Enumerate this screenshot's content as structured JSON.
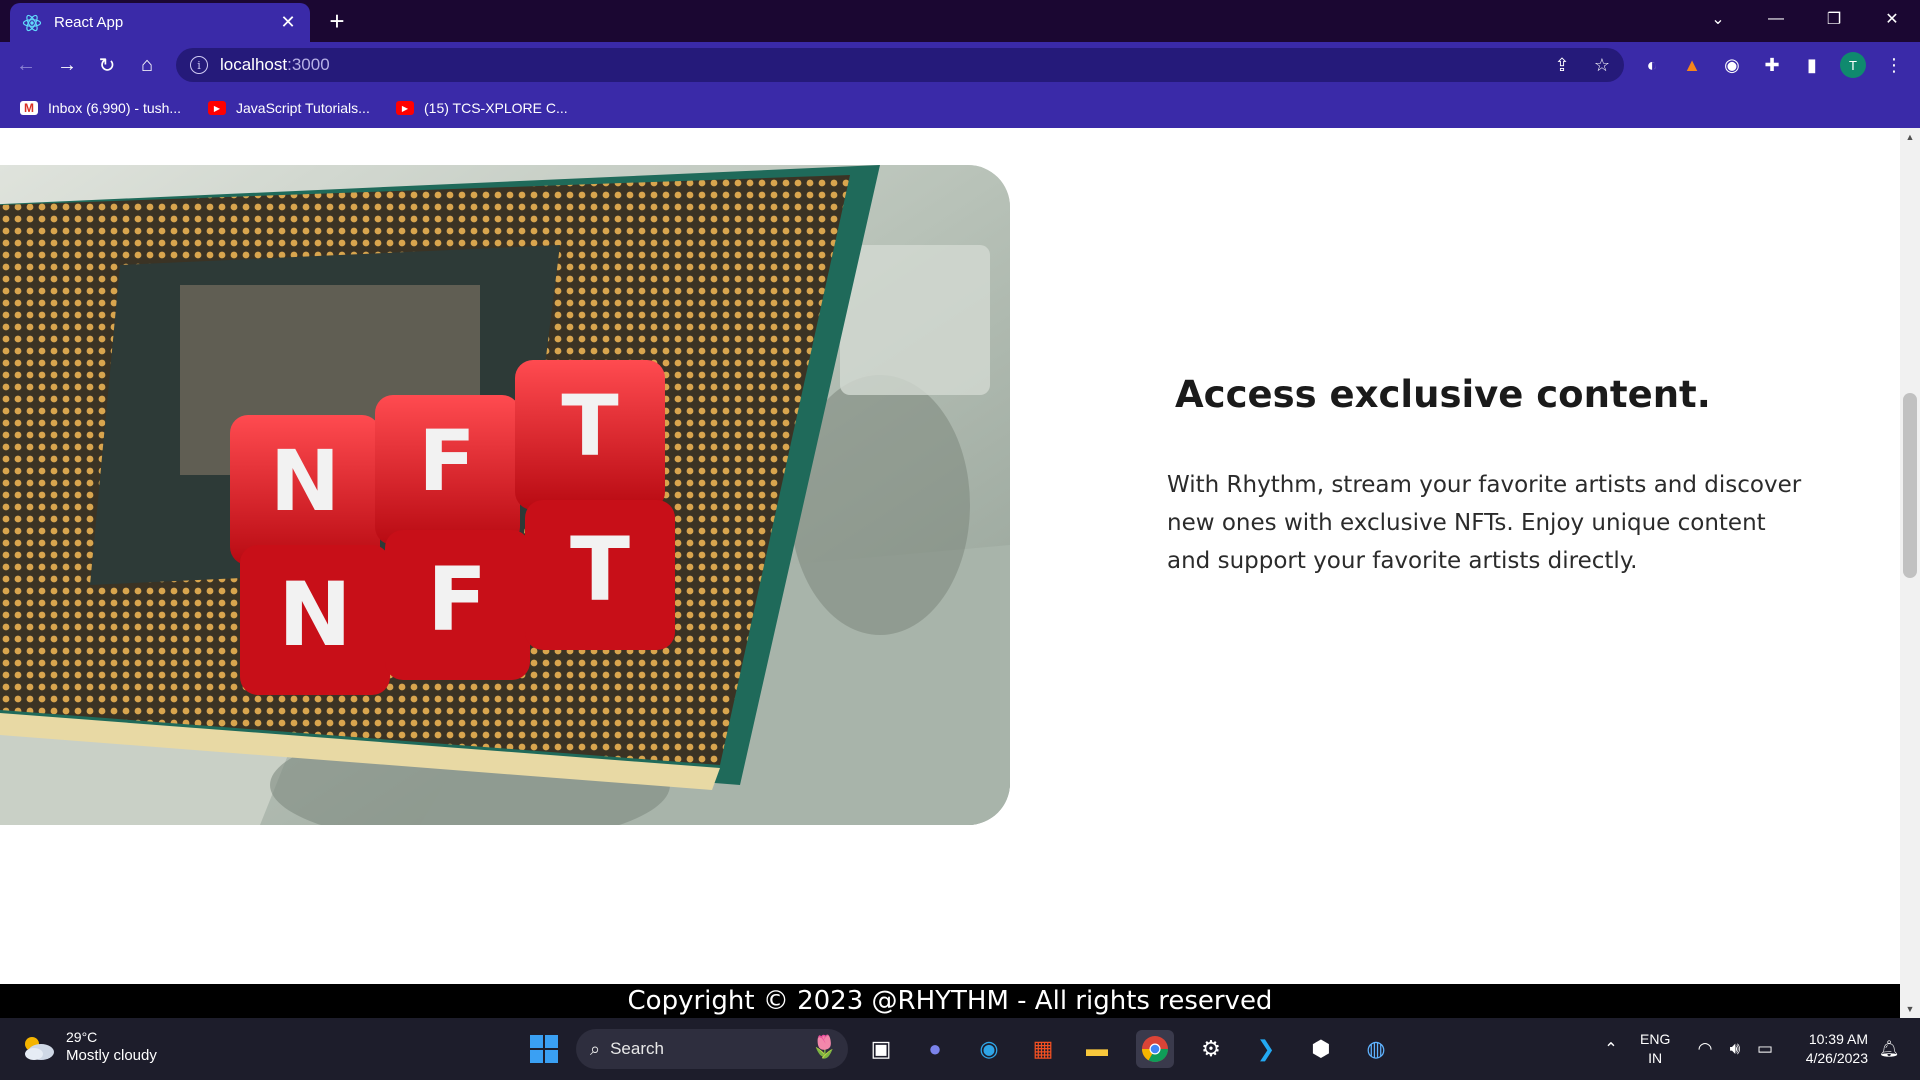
{
  "browser": {
    "tab_title": "React App",
    "new_tab_label": "+",
    "url_host": "localhost",
    "url_port": ":3000",
    "profile_initial": "T",
    "bookmarks": [
      {
        "label": "Inbox (6,990) - tush...",
        "icon": "gmail-icon"
      },
      {
        "label": "JavaScript Tutorials...",
        "icon": "youtube-icon"
      },
      {
        "label": "(15) TCS-XPLORE C...",
        "icon": "youtube-icon"
      }
    ]
  },
  "page": {
    "heading": "Access exclusive content.",
    "paragraph": "With Rhythm, stream your favorite artists and discover new ones with exclusive NFTs. Enjoy unique content and support your favorite artists directly.",
    "image_dice": [
      "N",
      "F",
      "T"
    ],
    "footer": "Copyright © 2023 @RHYTHM - All rights reserved"
  },
  "taskbar": {
    "weather_temp": "29°C",
    "weather_desc": "Mostly cloudy",
    "search_label": "Search",
    "lang_top": "ENG",
    "lang_bottom": "IN",
    "time": "10:39 AM",
    "date": "4/26/2023"
  },
  "colors": {
    "tabbar": "#1b0732",
    "toolbar": "#3a2aa8",
    "footer": "#000000",
    "dice": "#e0141e",
    "chip_pins": "#d4a04a"
  }
}
